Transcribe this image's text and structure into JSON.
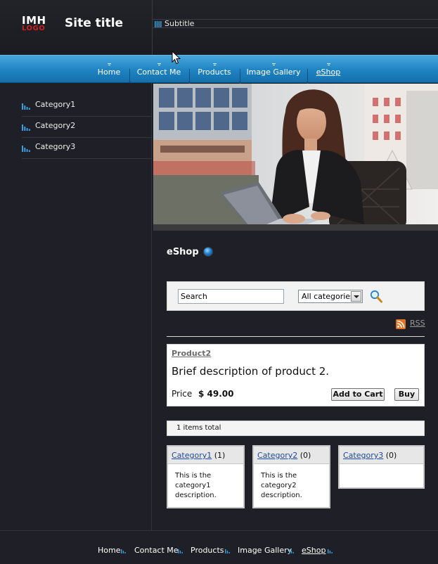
{
  "header": {
    "logo_top": "IMH",
    "logo_bottom": "LOGO",
    "site_title": "Site title",
    "subtitle": "Subtitle"
  },
  "nav": {
    "items": [
      {
        "label": "Home",
        "active": false
      },
      {
        "label": "Contact Me",
        "active": false
      },
      {
        "label": "Products",
        "active": false
      },
      {
        "label": "Image Gallery",
        "active": false
      },
      {
        "label": "eShop",
        "active": true
      }
    ]
  },
  "sidebar": {
    "categories": [
      "Category1",
      "Category2",
      "Category3"
    ]
  },
  "main": {
    "title": "eShop",
    "search": {
      "value": "Search",
      "category_selected": "All categories"
    },
    "rss_label": "RSS",
    "product": {
      "name": "Product2",
      "description": "Brief description of product 2.",
      "price_label": "Price",
      "price_value": "$ 49.00",
      "add_to_cart_label": "Add to Cart",
      "buy_label": "Buy"
    },
    "total": "1 items total",
    "category_boxes": [
      {
        "name": "Category1",
        "count": "(1)",
        "description": "This is the category1 description."
      },
      {
        "name": "Category2",
        "count": "(0)",
        "description": "This is the category2 description."
      },
      {
        "name": "Category3",
        "count": "(0)",
        "description": ""
      }
    ]
  },
  "footer": {
    "items": [
      {
        "label": "Home",
        "active": false
      },
      {
        "label": "Contact Me",
        "active": false
      },
      {
        "label": "Products",
        "active": false
      },
      {
        "label": "Image Gallery",
        "active": false
      },
      {
        "label": "eShop",
        "active": true
      }
    ]
  },
  "colors": {
    "background": "#1f2027",
    "nav_blue": "#1f83c2",
    "accent_blue": "#2a8fd6",
    "logo_red": "#d21f1f",
    "rss_orange": "#e8721c"
  },
  "icons": {
    "category_bullet": "bar-chart-icon",
    "search_button": "magnifier-icon",
    "rss": "rss-feed-icon",
    "title_bullet": "blue-orb-icon"
  }
}
